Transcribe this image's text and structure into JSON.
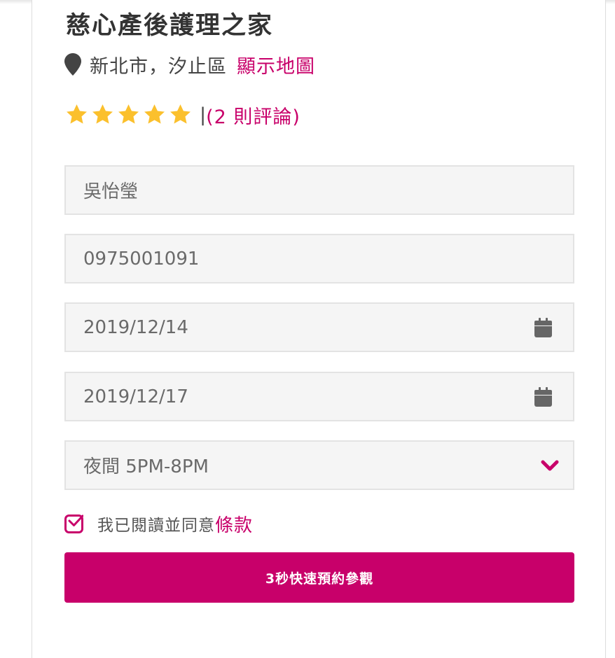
{
  "facility": {
    "name": "慈心產後護理之家",
    "location": "新北市，汐止區",
    "map_link": "顯示地圖"
  },
  "rating": {
    "stars": 5,
    "max_stars": 5,
    "separator": "|",
    "reviews_text": "(2 則評論)"
  },
  "form": {
    "name_value": "吳怡瑩",
    "phone_value": "0975001091",
    "start_date": "2019/12/14",
    "end_date": "2019/12/17",
    "time_slot": "夜間 5PM-8PM",
    "agree_text": "我已閱讀並同意",
    "terms_link": "條款",
    "agree_checked": true,
    "submit_label": "3秒快速預約參觀"
  },
  "icons": {
    "location": "map-pin-icon",
    "star": "star-icon",
    "calendar": "calendar-icon",
    "dropdown": "chevron-down-icon",
    "checkbox": "checkbox-checked-icon"
  },
  "colors": {
    "accent": "#c8006a",
    "star": "#fbc02d",
    "field_bg": "#f5f5f5",
    "field_border": "#e3e3e3",
    "text": "#333333"
  }
}
